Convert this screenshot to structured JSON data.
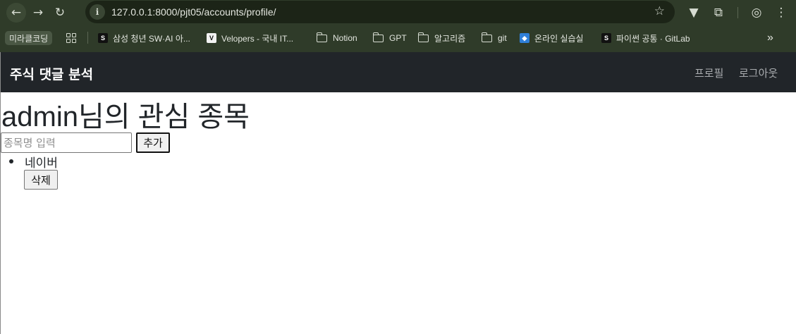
{
  "browser": {
    "url": "127.0.0.1:8000/pjt05/accounts/profile/",
    "bookmarks": [
      {
        "label": "미라클코딩",
        "type": "chip"
      },
      {
        "label": "삼성 청년 SW·AI 아...",
        "icon": "ssafy-favicon"
      },
      {
        "label": "Velopers - 국내 IT...",
        "icon": "velog-favicon"
      },
      {
        "label": "Notion",
        "icon": "folder-icon"
      },
      {
        "label": "GPT",
        "icon": "folder-icon"
      },
      {
        "label": "알고리즘",
        "icon": "folder-icon"
      },
      {
        "label": "git",
        "icon": "folder-icon"
      },
      {
        "label": "온라인 실습실",
        "icon": "blue-favicon"
      },
      {
        "label": "파이썬 공통 · GitLab",
        "icon": "ssafy-favicon"
      }
    ],
    "more_bookmarks": "»"
  },
  "navbar": {
    "brand": "주식 댓글 분석",
    "links": {
      "profile": "프로필",
      "logout": "로그아웃"
    }
  },
  "main": {
    "title": "admin님의 관심 종목",
    "search": {
      "placeholder": "종목명 입력",
      "value": ""
    },
    "add_label": "추가",
    "items": [
      {
        "name": "네이버",
        "delete_label": "삭제"
      }
    ]
  },
  "colors": {
    "chrome_bg": "#2f3b29",
    "omnibox_bg": "#1c2417",
    "navbar_bg": "#212529",
    "nav_link": "#a9acaf"
  }
}
